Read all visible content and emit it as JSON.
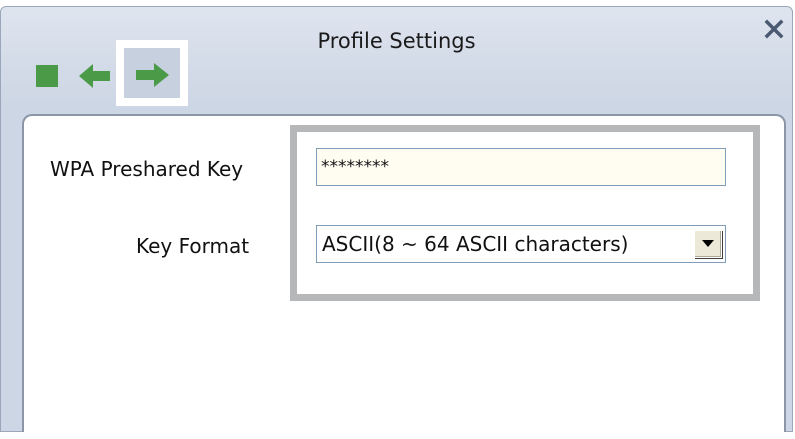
{
  "window": {
    "title": "Profile Settings"
  },
  "toolbar": {
    "stop_icon": "stop-icon",
    "back_icon": "back-arrow-icon",
    "next_icon": "next-arrow-icon",
    "close_icon": "close-icon",
    "icon_color": "#4a9a47"
  },
  "form": {
    "psk_label": "WPA Preshared Key",
    "psk_value": "********",
    "format_label": "Key Format",
    "format_selected": "ASCII(8 ~ 64 ASCII characters)"
  }
}
